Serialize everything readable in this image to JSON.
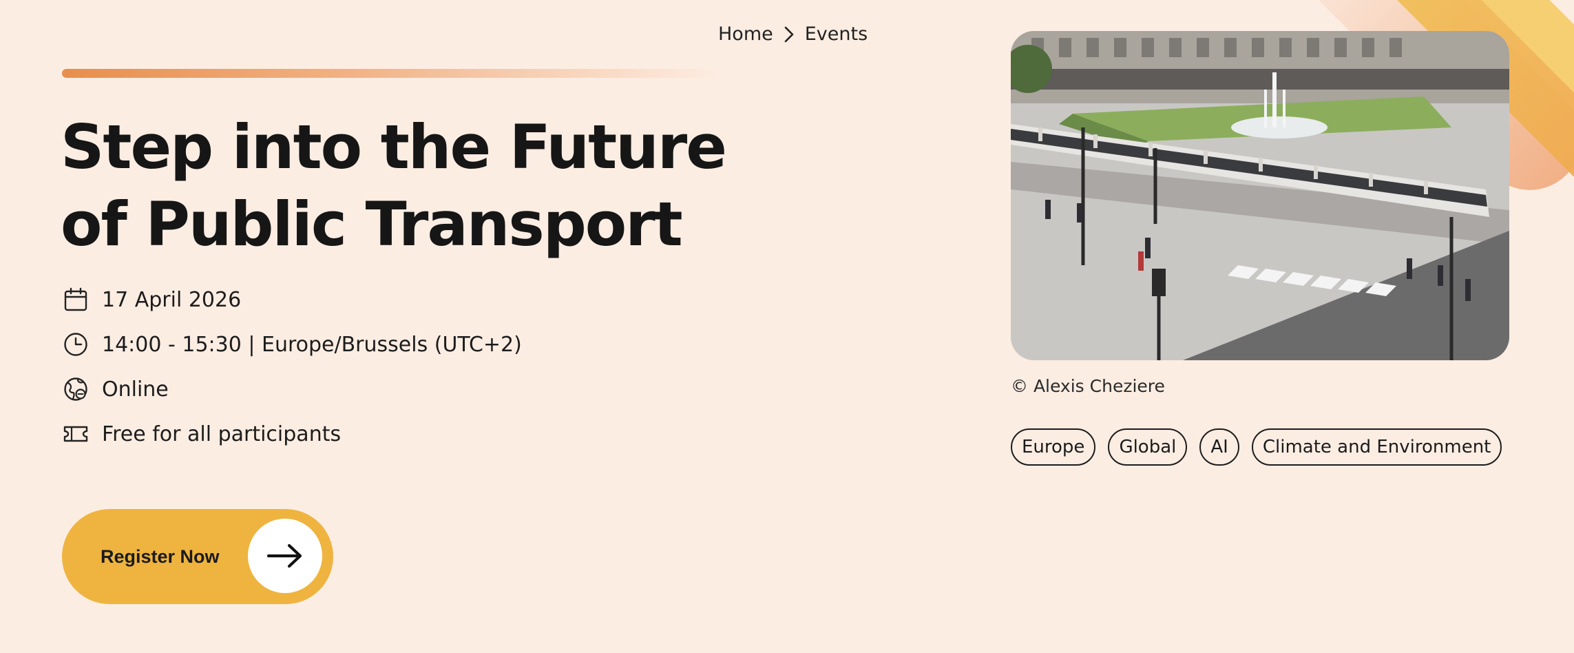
{
  "breadcrumb": {
    "home": "Home",
    "current": "Events"
  },
  "hero": {
    "title_line1": "Step into the Future",
    "title_line2": "of Public Transport"
  },
  "meta": {
    "date": "17 April 2026",
    "time": "14:00 - 15:30 | Europe/Brussels (UTC+2)",
    "location": "Online",
    "price": "Free for all participants"
  },
  "cta": {
    "register_label": "Register Now"
  },
  "image": {
    "credit": "© Alexis Cheziere"
  },
  "tags": [
    "Europe",
    "Global",
    "AI",
    "Climate and Environment"
  ],
  "colors": {
    "background": "#fcede3",
    "accent_orange": "#e88e4c",
    "button_yellow": "#efb43f",
    "text": "#161616"
  },
  "icons": [
    "chevron-right-icon",
    "calendar-icon",
    "clock-icon",
    "globe-icon",
    "ticket-icon",
    "arrow-right-icon"
  ]
}
